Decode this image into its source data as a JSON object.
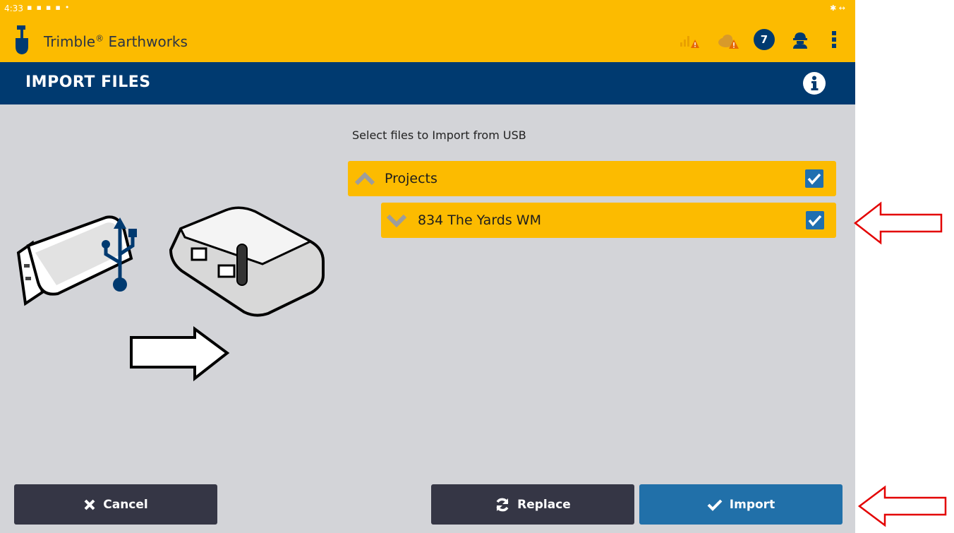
{
  "status_bar": {
    "time": "4:33"
  },
  "app": {
    "title": "Trimble",
    "registered_mark": "®",
    "title_suffix": " Earthworks",
    "notification_count": "7"
  },
  "header": {
    "title": "IMPORT FILES"
  },
  "main": {
    "prompt": "Select files to Import from USB",
    "tree": [
      {
        "label": "Projects",
        "expanded": true,
        "checked": true
      },
      {
        "label": "834 The Yards WM",
        "expanded": false,
        "checked": true
      }
    ]
  },
  "buttons": {
    "cancel": "Cancel",
    "replace": "Replace",
    "import": "Import"
  },
  "colors": {
    "accent_yellow": "#fcbb00",
    "header_blue": "#003a70",
    "import_blue": "#2170a9",
    "dark_button": "#353645",
    "annotation_red": "#e30000"
  },
  "icons": [
    "shovel-logo-icon",
    "signal-warning-icon",
    "cloud-warning-icon",
    "operator-icon",
    "more-vert-icon",
    "info-icon",
    "chevron-up-icon",
    "chevron-down-icon",
    "checkbox-checked-icon",
    "close-icon",
    "refresh-icon",
    "checkmark-icon"
  ]
}
